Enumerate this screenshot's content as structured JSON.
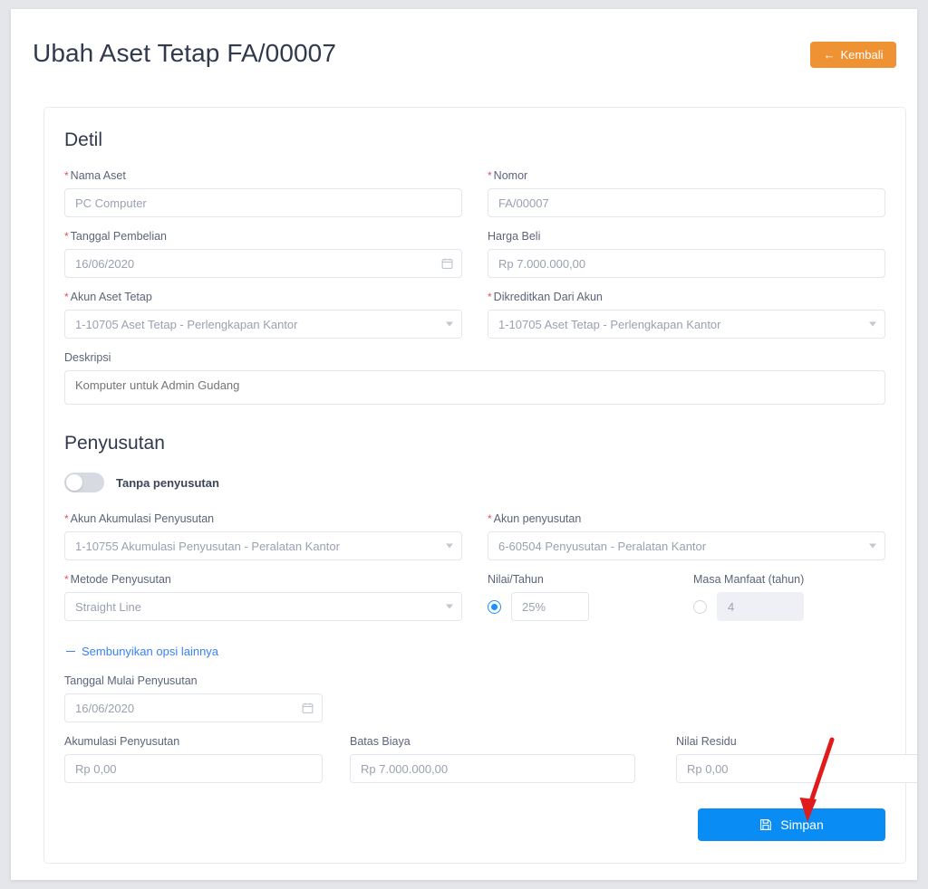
{
  "header": {
    "title": "Ubah Aset Tetap FA/00007",
    "back_button": "Kembali",
    "back_icon": "arrow-left-icon"
  },
  "detail_section": {
    "title": "Detil",
    "fields": {
      "nama_aset": {
        "label": "Nama Aset",
        "required": true,
        "value": "PC Computer"
      },
      "nomor": {
        "label": "Nomor",
        "required": true,
        "value": "FA/00007"
      },
      "tanggal_pembelian": {
        "label": "Tanggal Pembelian",
        "required": true,
        "value": "16/06/2020",
        "icon": "calendar-icon"
      },
      "harga_beli": {
        "label": "Harga Beli",
        "required": false,
        "value": "Rp 7.000.000,00"
      },
      "akun_aset_tetap": {
        "label": "Akun Aset Tetap",
        "required": true,
        "value": "1-10705 Aset Tetap - Perlengkapan Kantor",
        "icon": "chevron-down-icon"
      },
      "dikreditkan_dari_akun": {
        "label": "Dikreditkan Dari Akun",
        "required": true,
        "value": "1-10705 Aset Tetap - Perlengkapan Kantor",
        "icon": "chevron-down-icon"
      },
      "deskripsi": {
        "label": "Deskripsi",
        "required": false,
        "value": "Komputer untuk Admin Gudang"
      }
    }
  },
  "depreciation_section": {
    "title": "Penyusutan",
    "toggle": {
      "label": "Tanpa penyusutan",
      "checked": false
    },
    "fields": {
      "akun_akumulasi_penyusutan": {
        "label": "Akun Akumulasi Penyusutan",
        "required": true,
        "value": "1-10755 Akumulasi Penyusutan - Peralatan Kantor",
        "icon": "chevron-down-icon"
      },
      "akun_penyusutan": {
        "label": "Akun penyusutan",
        "required": true,
        "value": "6-60504 Penyusutan - Peralatan Kantor",
        "icon": "chevron-down-icon"
      },
      "metode_penyusutan": {
        "label": "Metode Penyusutan",
        "required": true,
        "value": "Straight Line",
        "icon": "chevron-down-icon"
      },
      "nilai_per_tahun": {
        "label": "Nilai/Tahun",
        "required": false,
        "value": "25%",
        "selected": true
      },
      "masa_manfaat": {
        "label": "Masa Manfaat (tahun)",
        "required": false,
        "value": "4",
        "selected": false,
        "disabled": true
      },
      "tanggal_mulai_penyusutan": {
        "label": "Tanggal Mulai Penyusutan",
        "required": false,
        "value": "16/06/2020",
        "icon": "calendar-icon"
      },
      "akumulasi_penyusutan": {
        "label": "Akumulasi Penyusutan",
        "required": false,
        "value": "Rp 0,00"
      },
      "batas_biaya": {
        "label": "Batas Biaya",
        "required": false,
        "value": "Rp 7.000.000,00"
      },
      "nilai_residu": {
        "label": "Nilai Residu",
        "required": false,
        "value": "Rp 0,00"
      }
    },
    "options_toggle": {
      "label": "Sembunyikan opsi lainnya",
      "icon": "minus-icon"
    }
  },
  "footer": {
    "save_button": "Simpan",
    "save_icon": "save-disk-icon"
  },
  "annotation": {
    "type": "arrow-pointer",
    "color": "#e01b1b",
    "points_to": "save-button"
  },
  "colors": {
    "back_button": "#ef9234",
    "save_button": "#0a8cf5",
    "required_marker": "#e8505b",
    "link": "#3b82f6",
    "annotation": "#e01b1b"
  }
}
